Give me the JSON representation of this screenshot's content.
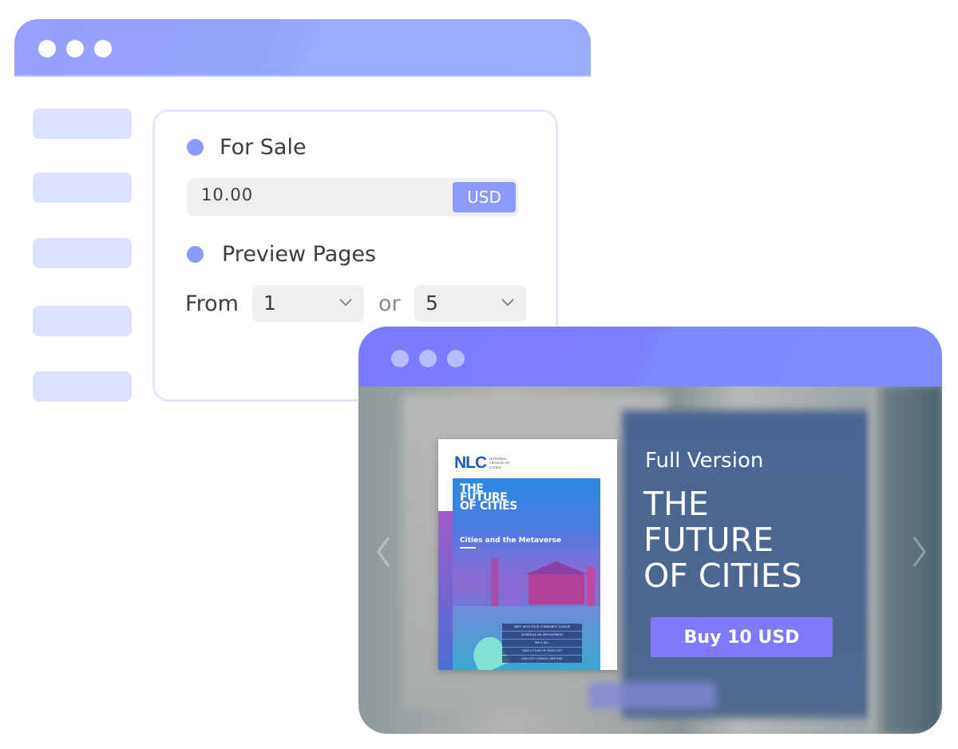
{
  "settings_window": {
    "sidebar_item_count": 5,
    "sections": {
      "for_sale": {
        "title": "For Sale",
        "price_value": "10.00",
        "currency": "USD"
      },
      "preview_pages": {
        "title": "Preview Pages",
        "from_label": "From",
        "from_value": "1",
        "or_label": "or",
        "to_value": "5"
      }
    }
  },
  "preview_window": {
    "cover": {
      "logo": "NLC",
      "org_name": "National League of Cities",
      "title_lines": [
        "THE",
        "FUTURE",
        "OF CITIES"
      ],
      "subtitle": "Cities and the Metaverse",
      "menu_items": [
        "Meet with your community liaison",
        "Schedule an appointment",
        "Pay a bill",
        "Take a tour of your city",
        "Join city council meeting"
      ]
    },
    "label": "Full Version",
    "title_lines": [
      "THE",
      "FUTURE",
      "OF CITIES"
    ],
    "buy_button": "Buy 10 USD",
    "prev_icon": "chevron-left-icon",
    "next_icon": "chevron-right-icon"
  },
  "colors": {
    "accent": "#8c99f9",
    "buy_button": "#7f79f7",
    "sidebar_item": "#dce2fd",
    "back_titlebar": "#97a6fb",
    "front_titlebar": "#7b80fc"
  }
}
